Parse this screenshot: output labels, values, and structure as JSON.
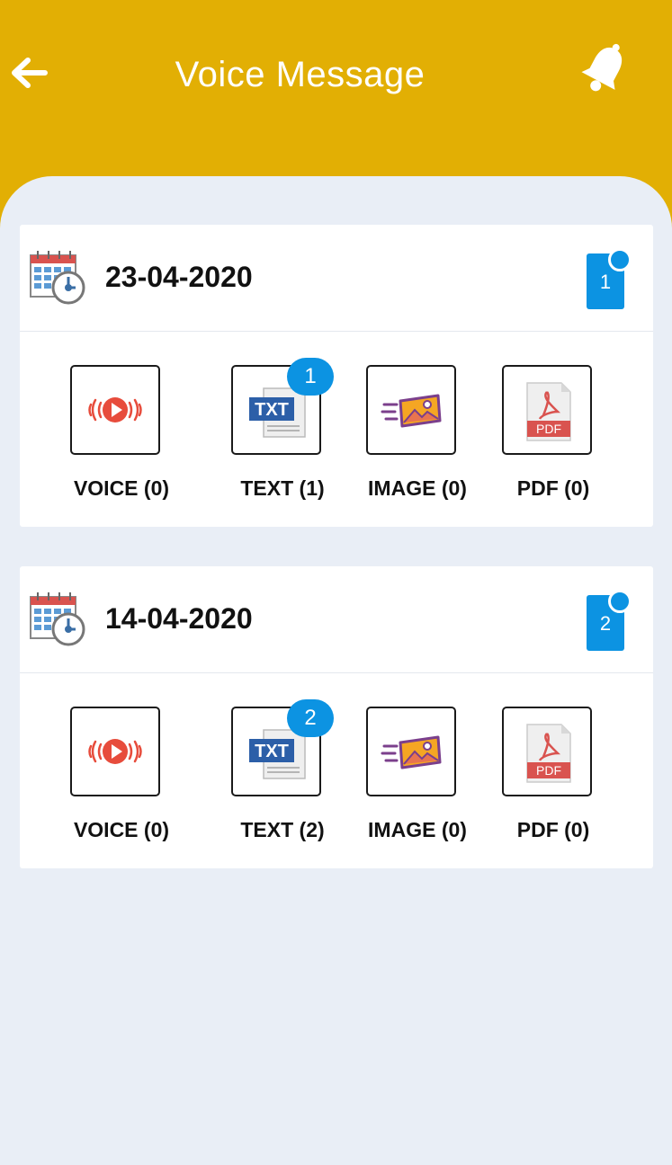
{
  "header": {
    "title": "Voice Message",
    "back_icon": "arrow-left-icon",
    "notify_icon": "bell-icon",
    "color": "#E2AF04"
  },
  "cards": [
    {
      "date": "23-04-2020",
      "count": "1",
      "text_badge": "1",
      "items": {
        "voice": "VOICE (0)",
        "text": "TEXT (1)",
        "image": "IMAGE (0)",
        "pdf": "PDF (0)"
      }
    },
    {
      "date": "14-04-2020",
      "count": "2",
      "text_badge": "2",
      "items": {
        "voice": "VOICE (0)",
        "text": "TEXT (2)",
        "image": "IMAGE (0)",
        "pdf": "PDF (0)"
      }
    }
  ],
  "icons": {
    "file_txt": "TXT",
    "file_pdf": "PDF"
  },
  "colors": {
    "accent": "#0C93E2",
    "background": "#E9EEF6"
  }
}
